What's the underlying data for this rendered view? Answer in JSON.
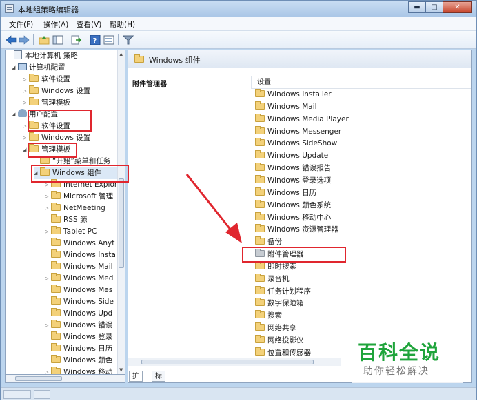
{
  "window": {
    "title": "本地组策略编辑器"
  },
  "window_buttons": {
    "minimize": "▬",
    "maximize": "□",
    "close": "✕"
  },
  "menu": [
    {
      "label": "文件(F)"
    },
    {
      "label": "操作(A)"
    },
    {
      "label": "查看(V)"
    },
    {
      "label": "帮助(H)"
    }
  ],
  "toolbar": [
    "back-arrow-icon",
    "forward-arrow-icon",
    "up-folder-icon",
    "show-hide-tree-icon",
    "export-list-icon",
    "help-icon",
    "properties-icon",
    "filter-icon"
  ],
  "tree": {
    "root": "本地计算机 策略",
    "computer_config": "计算机配置",
    "cc_software": "软件设置",
    "cc_windows": "Windows 设置",
    "cc_admin": "管理模板",
    "user_config": "用户配置",
    "uc_software": "软件设置",
    "uc_windows": "Windows 设置",
    "uc_admin": "管理模板",
    "start_menu": "“开始”菜单和任务",
    "win_components": "Windows 组件",
    "children": [
      "Internet Explor",
      "Microsoft 管理",
      "NetMeeting",
      "RSS 源",
      "Tablet PC",
      "Windows Anyt",
      "Windows Insta",
      "Windows Mail",
      "Windows Med",
      "Windows Mes",
      "Windows Side",
      "Windows Upd",
      "Windows 错误",
      "Windows 登录",
      "Windows 日历",
      "Windows 颜色",
      "Windows 移动"
    ]
  },
  "right_pane": {
    "header_title": "Windows 组件",
    "desc_title": "附件管理器",
    "column_header": "设置",
    "items": [
      "Windows Installer",
      "Windows Mail",
      "Windows Media Player",
      "Windows Messenger",
      "Windows SideShow",
      "Windows Update",
      "Windows 错误报告",
      "Windows 登录选项",
      "Windows 日历",
      "Windows 颜色系统",
      "Windows 移动中心",
      "Windows 资源管理器",
      "备份",
      "附件管理器",
      "即时搜索",
      "录音机",
      "任务计划程序",
      "数字保险箱",
      "搜索",
      "网络共享",
      "网络投影仪",
      "位置和传感器"
    ],
    "tabs": [
      "扩展",
      "标准"
    ]
  },
  "watermark": {
    "main": "百科全说",
    "sub": "助你轻松解决"
  },
  "colors": {
    "highlight": "#e0262e",
    "folder": "#f3d17a",
    "watermark_green": "#1fa43b"
  }
}
